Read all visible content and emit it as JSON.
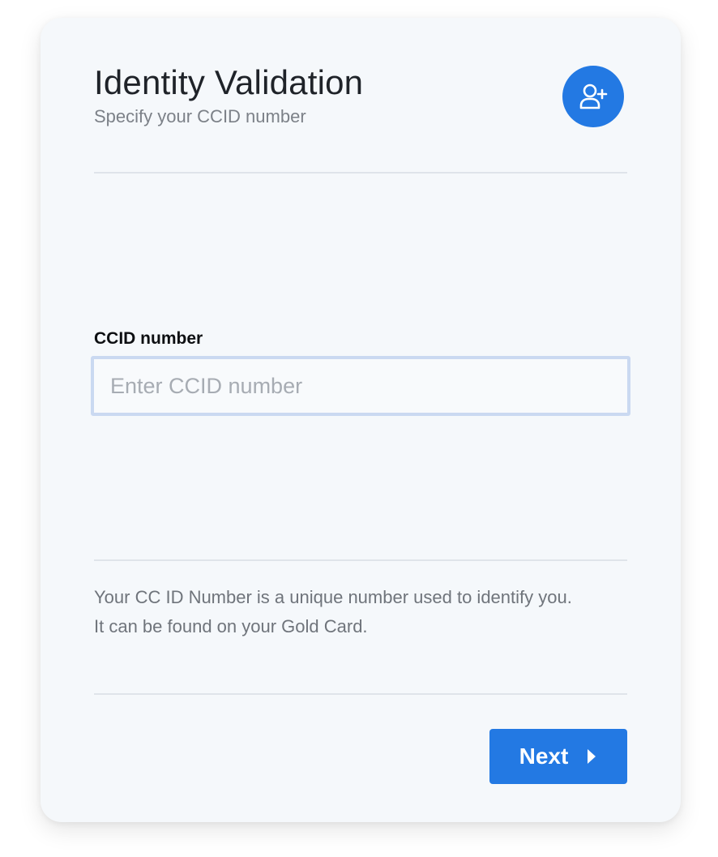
{
  "header": {
    "title": "Identity Validation",
    "subtitle": "Specify your CCID number",
    "action_icon": "add-user-icon"
  },
  "form": {
    "ccid": {
      "label": "CCID number",
      "placeholder": "Enter CCID number",
      "value": ""
    }
  },
  "help": {
    "line1": "Your CC ID Number is a unique number used to identify you.",
    "line2": "It can be found on your Gold Card."
  },
  "footer": {
    "next_label": "Next",
    "next_icon": "caret-right-icon"
  },
  "colors": {
    "accent": "#2379e3",
    "card_background": "#f5f8fb",
    "input_focus_border": "#cad9f1"
  }
}
